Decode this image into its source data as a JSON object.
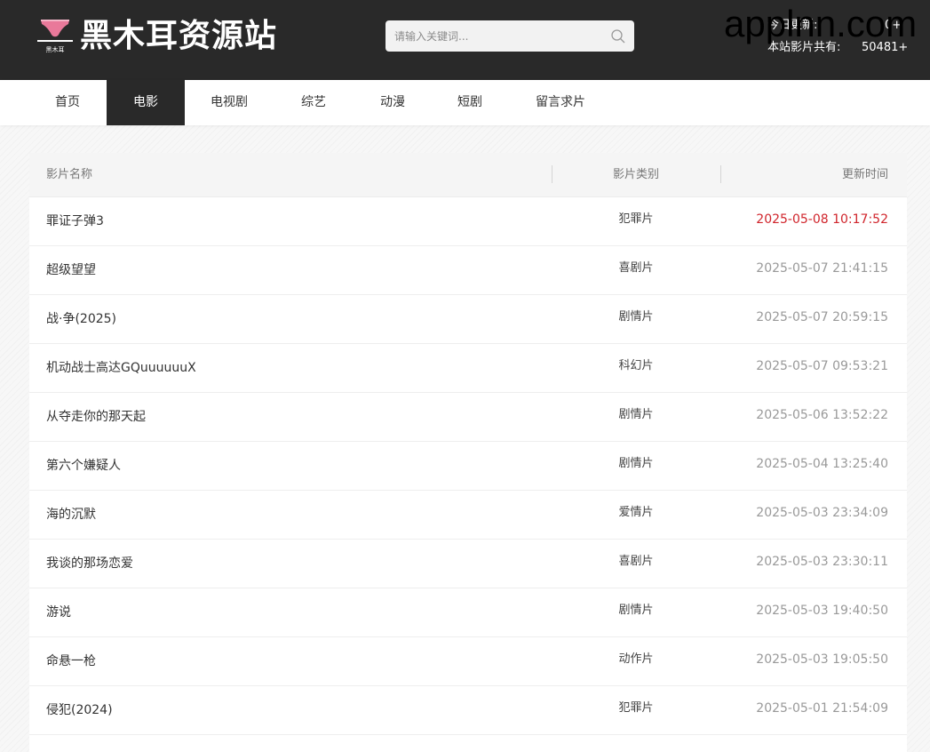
{
  "header": {
    "logo_small_text": "黑木耳",
    "site_title": "黑木耳资源站",
    "search_placeholder": "请输入关键词...",
    "stats": [
      {
        "label": "今日更新:",
        "value": "0+"
      },
      {
        "label": "本站影片共有:",
        "value": "50481+"
      }
    ],
    "watermark": "applnn.com"
  },
  "nav": [
    {
      "label": "首页"
    },
    {
      "label": "电影"
    },
    {
      "label": "电视剧"
    },
    {
      "label": "综艺"
    },
    {
      "label": "动漫"
    },
    {
      "label": "短剧"
    },
    {
      "label": "留言求片"
    }
  ],
  "nav_active": "电影",
  "table": {
    "headers": {
      "name": "影片名称",
      "type": "影片类别",
      "time": "更新时间"
    },
    "rows": [
      {
        "name": "罪证子弹3",
        "type": "犯罪片",
        "time": "2025-05-08 10:17:52"
      },
      {
        "name": "超级望望",
        "type": "喜剧片",
        "time": "2025-05-07 21:41:15"
      },
      {
        "name": "战·争(2025)",
        "type": "剧情片",
        "time": "2025-05-07 20:59:15"
      },
      {
        "name": "机动战士高达GQuuuuuuX",
        "type": "科幻片",
        "time": "2025-05-07 09:53:21"
      },
      {
        "name": "从夺走你的那天起",
        "type": "剧情片",
        "time": "2025-05-06 13:52:22"
      },
      {
        "name": "第六个嫌疑人",
        "type": "剧情片",
        "time": "2025-05-04 13:25:40"
      },
      {
        "name": "海的沉默",
        "type": "爱情片",
        "time": "2025-05-03 23:34:09"
      },
      {
        "name": "我谈的那场恋爱",
        "type": "喜剧片",
        "time": "2025-05-03 23:30:11"
      },
      {
        "name": "游说",
        "type": "剧情片",
        "time": "2025-05-03 19:40:50"
      },
      {
        "name": "命悬一枪",
        "type": "动作片",
        "time": "2025-05-03 19:05:50"
      },
      {
        "name": "侵犯(2024)",
        "type": "犯罪片",
        "time": "2025-05-01 21:54:09"
      }
    ]
  },
  "colors": {
    "header_bg": "#292929",
    "nav_active_bg": "#292929",
    "latest_time": "#d0242b",
    "logo_pink": "#e9799a"
  }
}
